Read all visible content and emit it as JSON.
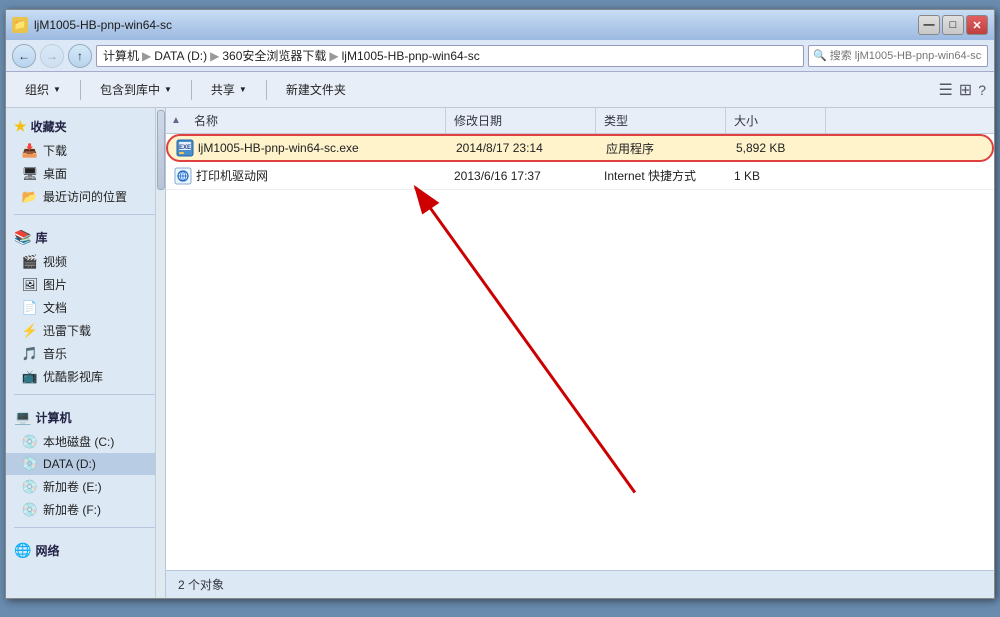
{
  "window": {
    "title": "ljM1005-HB-pnp-win64-sc",
    "min_btn": "—",
    "max_btn": "□",
    "close_btn": "✕"
  },
  "nav": {
    "back_tooltip": "后退",
    "forward_tooltip": "前进",
    "up_tooltip": "向上",
    "breadcrumb": [
      {
        "label": "计算机"
      },
      {
        "label": "DATA (D:)"
      },
      {
        "label": "360安全浏览器下载"
      },
      {
        "label": "ljM1005-HB-pnp-win64-sc"
      }
    ],
    "search_placeholder": "搜索 ljM1005-HB-pnp-win64-sc"
  },
  "toolbar": {
    "organize_label": "组织",
    "include_label": "包含到库中",
    "share_label": "共享",
    "new_folder_label": "新建文件夹"
  },
  "sidebar": {
    "favorites_label": "收藏夹",
    "favorites_items": [
      {
        "label": "下载",
        "icon": "📥"
      },
      {
        "label": "桌面",
        "icon": "🖥"
      },
      {
        "label": "最近访问的位置",
        "icon": "📂"
      }
    ],
    "library_label": "库",
    "library_items": [
      {
        "label": "视频",
        "icon": "🎬"
      },
      {
        "label": "图片",
        "icon": "🖼"
      },
      {
        "label": "文档",
        "icon": "📄"
      },
      {
        "label": "迅雷下载",
        "icon": "⚡"
      },
      {
        "label": "音乐",
        "icon": "🎵"
      },
      {
        "label": "优酷影视库",
        "icon": "📺"
      }
    ],
    "computer_label": "计算机",
    "computer_items": [
      {
        "label": "本地磁盘 (C:)",
        "icon": "💾"
      },
      {
        "label": "DATA (D:)",
        "icon": "💾",
        "selected": true
      },
      {
        "label": "新加卷 (E:)",
        "icon": "💾"
      },
      {
        "label": "新加卷 (F:)",
        "icon": "💾"
      }
    ],
    "network_label": "网络"
  },
  "columns": {
    "name": "名称",
    "date": "修改日期",
    "type": "类型",
    "size": "大小"
  },
  "files": [
    {
      "name": "ljM1005-HB-pnp-win64-sc.exe",
      "date": "2014/8/17 23:14",
      "type": "应用程序",
      "size": "5,892 KB",
      "highlighted": true,
      "icon_type": "exe"
    },
    {
      "name": "打印机驱动网",
      "date": "2013/6/16 17:37",
      "type": "Internet 快捷方式",
      "size": "1 KB",
      "highlighted": false,
      "icon_type": "url"
    }
  ],
  "status": {
    "count_label": "2 个对象"
  }
}
